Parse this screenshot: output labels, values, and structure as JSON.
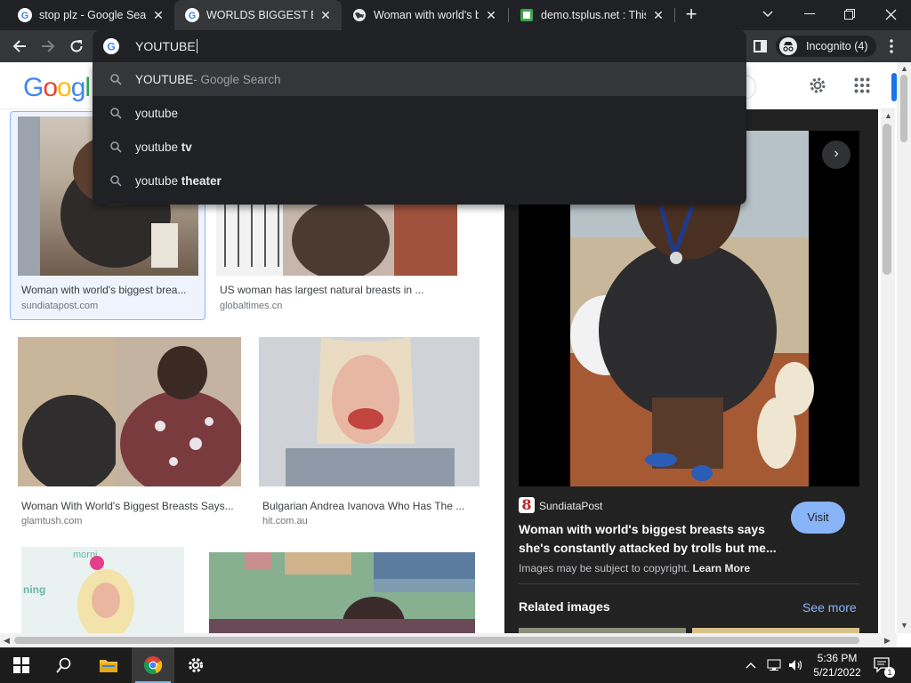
{
  "browser": {
    "tabs": [
      {
        "title": "stop plz - Google Search",
        "favicon": "google-icon"
      },
      {
        "title": "WORLDS BIGGEST BOOBS",
        "favicon": "google-icon",
        "active": true
      },
      {
        "title": "Woman with world's biggest",
        "favicon": "globe-icon"
      },
      {
        "title": "demo.tsplus.net : This c",
        "favicon": "tsplus-icon"
      }
    ],
    "newtab_label": "+",
    "omnibox_text": "YOUTUBE",
    "incognito_label": "Incognito (4)",
    "suggestions": [
      {
        "text": "YOUTUBE",
        "suffix": " - Google Search"
      },
      {
        "text": "youtube",
        "bold": ""
      },
      {
        "text": "youtube ",
        "bold": "tv"
      },
      {
        "text": "youtube ",
        "bold": "theater"
      }
    ]
  },
  "google": {
    "logo": "Google",
    "results": [
      {
        "caption": "Woman with world's biggest brea...",
        "source": "sundiatapost.com"
      },
      {
        "caption": "US woman has largest natural breasts in ...",
        "source": "globaltimes.cn"
      },
      {
        "caption": "Woman With World's Biggest Breasts Says...",
        "source": "glamtush.com"
      },
      {
        "caption": "Bulgarian Andrea Ivanova Who Has The ...",
        "source": "hit.com.au"
      }
    ],
    "panel": {
      "site": "SundiataPost",
      "logo_letter": "8",
      "title": "Woman with world's biggest breasts says she's constantly attacked by trolls but me...",
      "visit_label": "Visit",
      "copyright": "Images may be subject to copyright.",
      "learn_more": "Learn More",
      "related": "Related images",
      "see_more": "See more",
      "next_arrow": "›"
    },
    "thumb_text": {
      "morning_a": "morni",
      "morning_b": "ning"
    }
  },
  "taskbar": {
    "time": "5:36 PM",
    "date": "5/21/2022",
    "notification_count": "1"
  },
  "colors": {
    "chrome_dark": "#202124",
    "chrome_toolbar": "#35363a",
    "accent_blue": "#8ab4f8",
    "panel_bg": "#222222"
  }
}
